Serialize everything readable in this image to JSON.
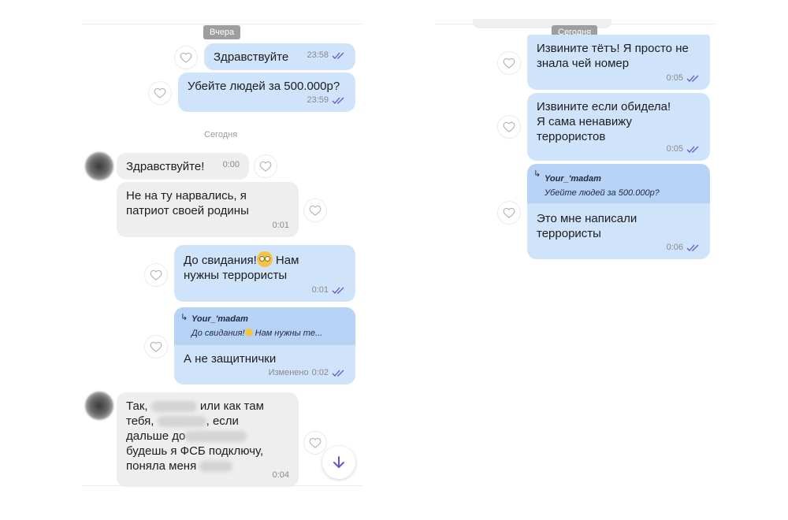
{
  "left": {
    "date_yesterday": "Вчера",
    "date_today": "Сегодня",
    "messages": [
      {
        "text": "Здравствуйте",
        "time": "23:58"
      },
      {
        "text": "Убейте людей за 500.000р?",
        "time": "23:59"
      },
      {
        "text": "Здравствуйте!",
        "time": "0:00"
      },
      {
        "text": "Не на ту нарвались, я\nпатриот своей родины",
        "time": "0:01"
      },
      {
        "text_a": "До свидания!",
        "text_b": " Нам",
        "text_c": "нужны террористы",
        "time": "0:01"
      },
      {
        "reply_author": "Your_'madam",
        "reply_quote_a": "До свидания!",
        "reply_quote_b": " Нам нужны те...",
        "text": "А не защитнички",
        "edited": "Изменено",
        "time": "0:02"
      },
      {
        "l1": "Так,",
        "l1b": "или как там",
        "l2": "тебя,",
        "l2b": ", если",
        "l3": "дальше до",
        "l4": "будешь я ФСБ подключу,",
        "l5": "поняла меня",
        "time": "0:04"
      }
    ]
  },
  "right": {
    "date_today": "Сегодня",
    "messages": [
      {
        "text": "Извините тётъ! Я просто не\nзнала чей номер",
        "time": "0:05"
      },
      {
        "text": "Извините если обидела!\nЯ сама ненавижу\nтеррористов",
        "time": "0:05"
      },
      {
        "reply_author": "Your_'madam",
        "reply_quote": "Убейте людей за 500.000р?",
        "text": "Это мне написали\nтеррористы",
        "time": "0:06"
      }
    ]
  },
  "colors": {
    "outgoing": "#cfe3fb",
    "incoming": "#eeeeee",
    "reply_header": "#b6d2f4",
    "accent": "#6b55c9"
  },
  "icons": {
    "like": "heart-icon",
    "read": "double-check-icon",
    "scroll": "arrow-down-icon",
    "reply": "reply-arrow-icon"
  }
}
